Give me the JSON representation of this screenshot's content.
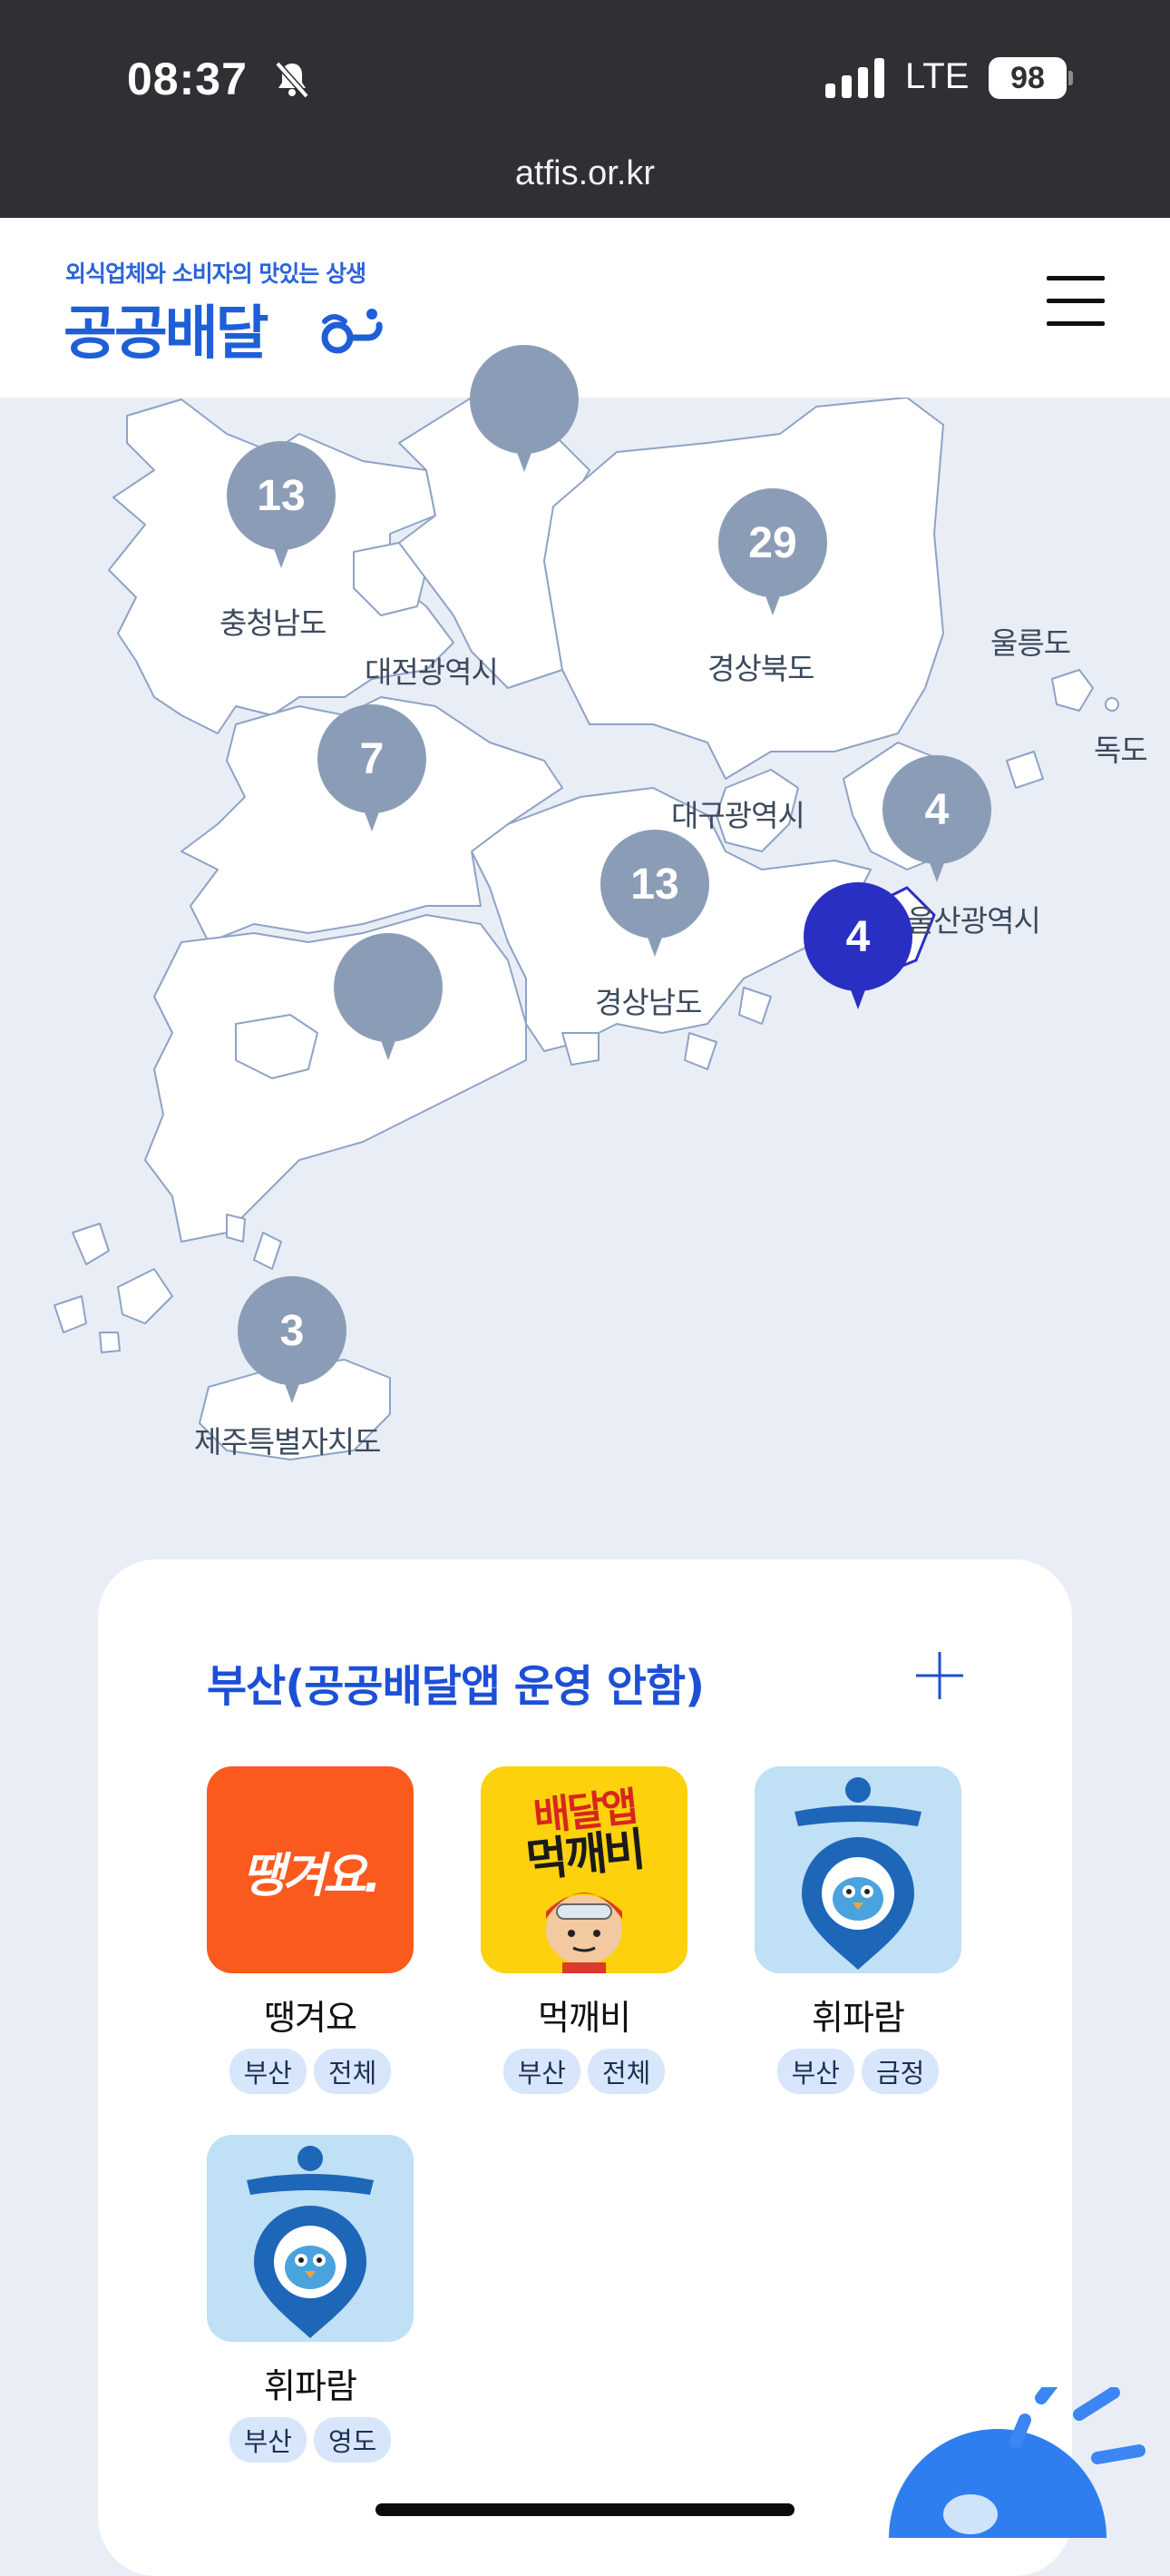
{
  "status_bar": {
    "time": "08:37",
    "network": "LTE",
    "battery": "98",
    "url": "atfis.or.kr"
  },
  "header": {
    "logo_subtitle": "외식업체와 소비자의 맛있는 상생",
    "logo_title": "공공배달"
  },
  "map": {
    "regions": [
      "충청남도",
      "대전광역시",
      "경상북도",
      "울릉도",
      "독도",
      "대구광역시",
      "울산광역시",
      "경상남도",
      "제주특별자치도"
    ],
    "markers": [
      "",
      "13",
      "29",
      "7",
      "4",
      "13",
      "4",
      "",
      "3"
    ],
    "selected_marker": "4"
  },
  "panel": {
    "title": "부산(공공배달앱 운영 안함)",
    "apps": [
      {
        "name": "땡겨요",
        "icon_text": "땡겨요.",
        "tags": [
          "부산",
          "전체"
        ],
        "color": "#fb5a1f"
      },
      {
        "name": "먹깨비",
        "icon_text": [
          "배달앱",
          "먹깨비"
        ],
        "tags": [
          "부산",
          "전체"
        ],
        "color": "#fdd10b"
      },
      {
        "name": "휘파람",
        "tags": [
          "부산",
          "금정"
        ],
        "color": "#bfe0f5"
      },
      {
        "name": "휘파람",
        "tags": [
          "부산",
          "영도"
        ],
        "color": "#bfe0f5"
      }
    ]
  },
  "colors": {
    "accent": "#1d4fd6",
    "marker": "#8b9db6",
    "marker_active": "#2a2fc4"
  }
}
